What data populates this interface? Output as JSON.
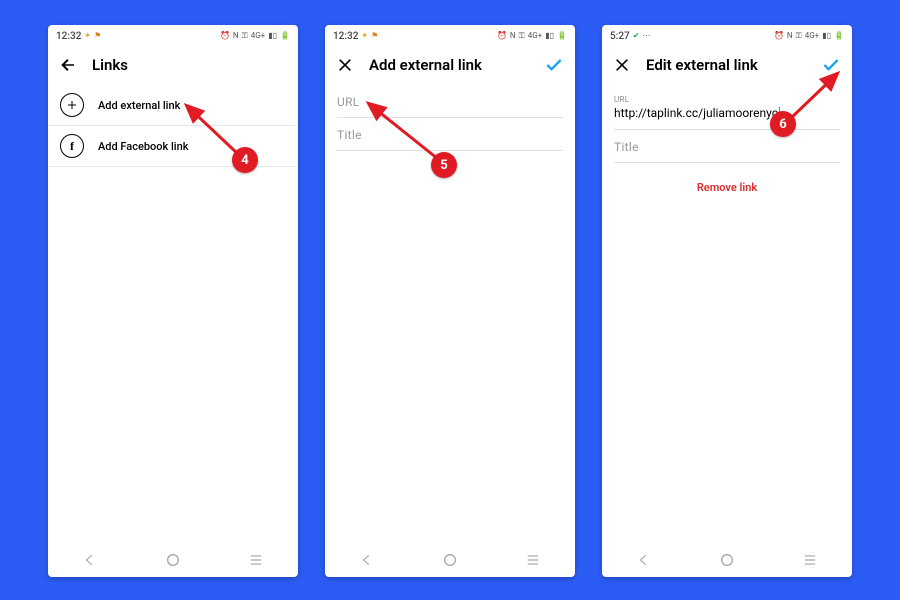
{
  "background_color": "#2c5cf6",
  "annotations": {
    "step4": "4",
    "step5": "5",
    "step6": "6"
  },
  "screen1": {
    "status": {
      "time": "12:32",
      "left_extra": "",
      "net_label": "N",
      "signal_label": "4G+"
    },
    "appbar": {
      "title": "Links"
    },
    "rows": {
      "add_external": "Add external link",
      "add_facebook": "Add Facebook link"
    }
  },
  "screen2": {
    "status": {
      "time": "12:32",
      "net_label": "N",
      "signal_label": "4G+"
    },
    "appbar": {
      "title": "Add external link"
    },
    "fields": {
      "url_label": "URL",
      "title_label": "Title"
    }
  },
  "screen3": {
    "status": {
      "time": "5:27",
      "net_label": "N",
      "signal_label": "4G+"
    },
    "appbar": {
      "title": "Edit external link"
    },
    "fields": {
      "url_label": "URL",
      "url_value": "http://taplink.cc/juliamoorenyc",
      "title_label": "Title"
    },
    "remove": "Remove link"
  }
}
